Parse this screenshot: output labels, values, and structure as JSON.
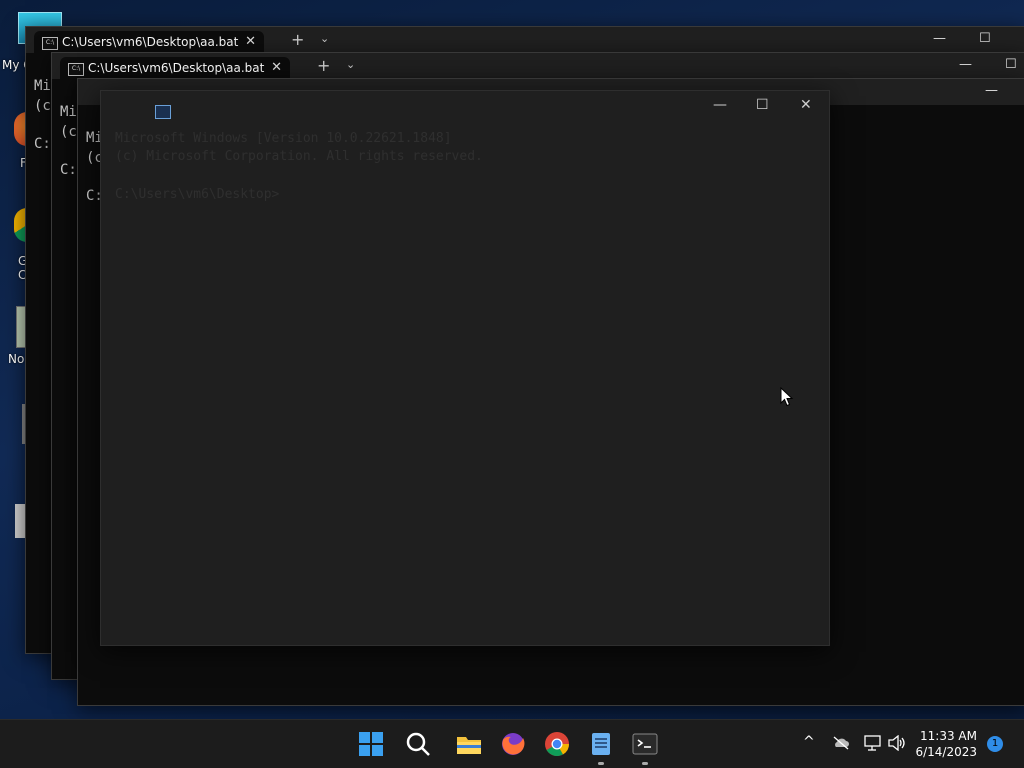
{
  "desktop": {
    "icons": [
      {
        "name": "my-computer",
        "label": "My C"
      },
      {
        "name": "firefox",
        "label": "F"
      },
      {
        "name": "google-chrome",
        "label": "G\nC"
      },
      {
        "name": "notepad",
        "label": "No"
      }
    ]
  },
  "terminal": {
    "tab_title": "C:\\Users\\vm6\\Desktop\\aa.bat",
    "tab_close": "✕",
    "tab_add": "+",
    "tab_dropdown": "⌄",
    "minimize": "—",
    "maximize": "☐",
    "close": "✕",
    "line1": "Mi",
    "line2": "(c",
    "prompt": "C:"
  },
  "ghost_window": {
    "minimize": "—",
    "maximize": "☐",
    "close": "✕",
    "line1": "Microsoft Windows [Version 10.0.22621.1848]",
    "line2": "(c) Microsoft Corporation. All rights reserved.",
    "prompt": "C:\\Users\\vm6\\Desktop>"
  },
  "taskbar": {
    "apps": [
      "start-icon",
      "search-icon",
      "file-explorer-icon",
      "firefox-icon",
      "chrome-icon",
      "notepad-icon",
      "terminal-icon"
    ],
    "tray_expand": "^",
    "time": "11:33 AM",
    "date": "6/14/2023",
    "notifications": "1"
  },
  "colors": {
    "terminal_bg": "#0c0c0c",
    "ghost_bg": "#1f1f1f",
    "taskbar_bg": "#1c1c1c",
    "accent": "#2f8de8"
  }
}
